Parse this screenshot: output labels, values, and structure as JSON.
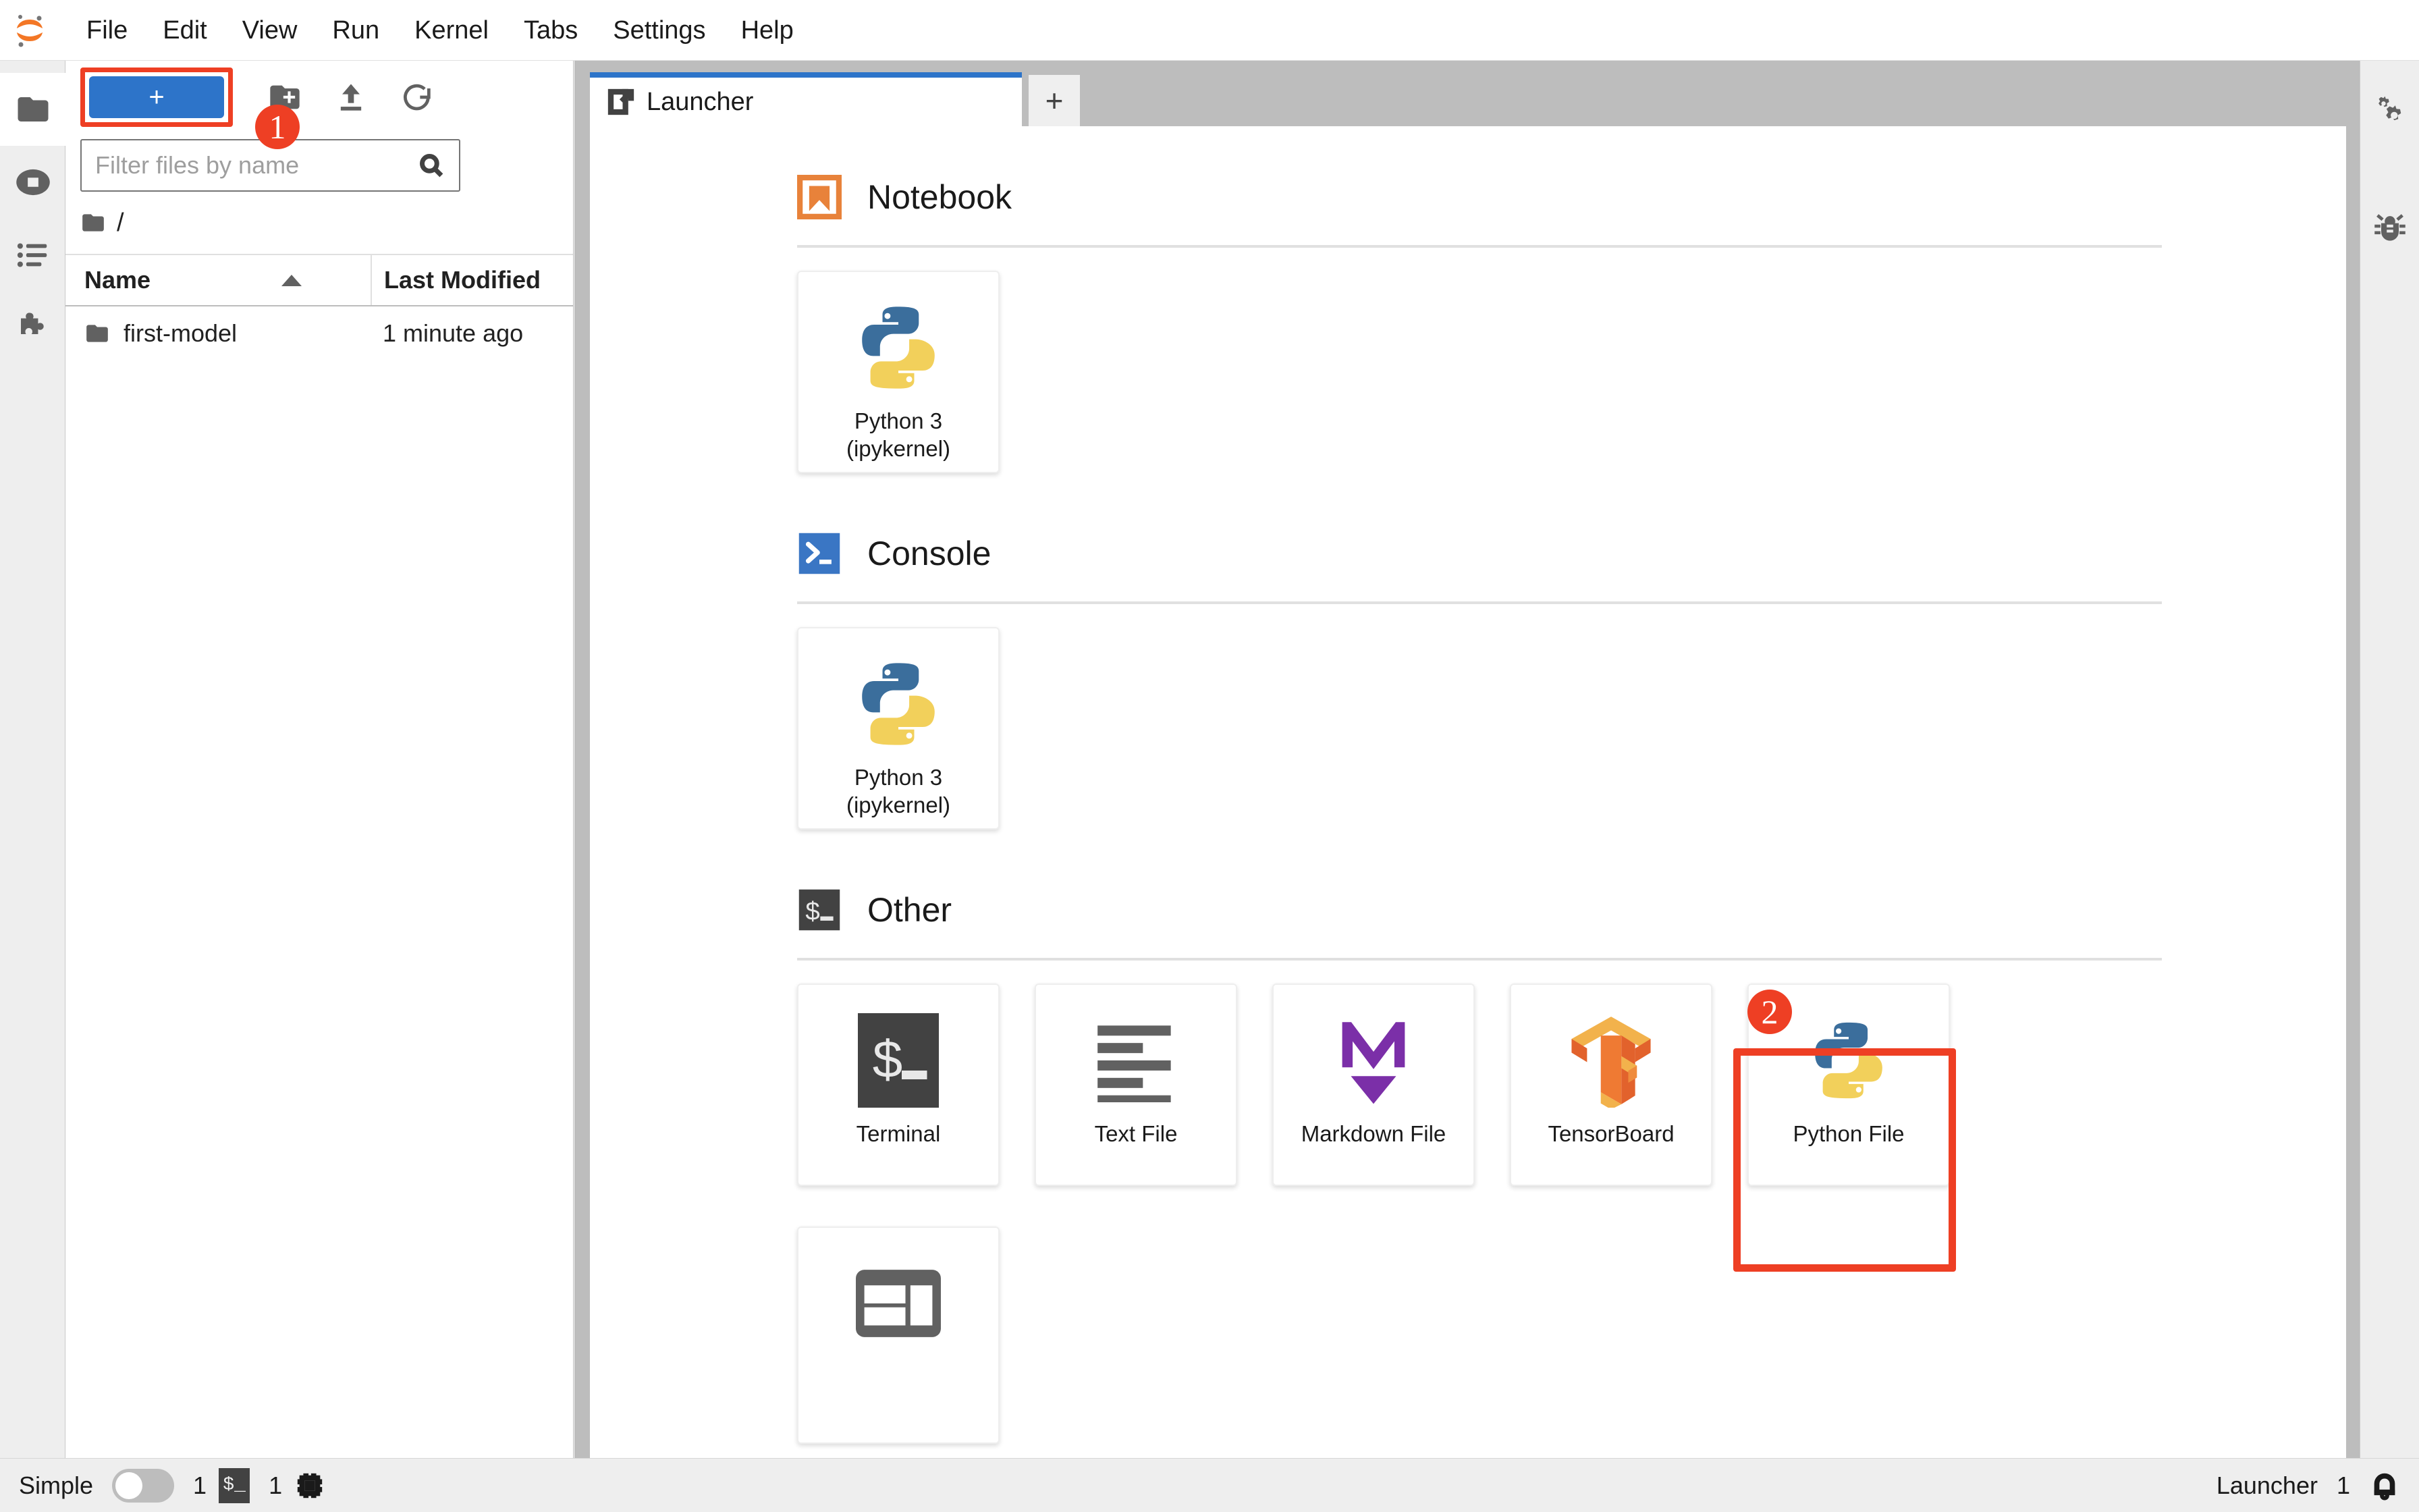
{
  "menubar": {
    "logo_name": "jupyter-logo",
    "items": [
      "File",
      "Edit",
      "View",
      "Run",
      "Kernel",
      "Tabs",
      "Settings",
      "Help"
    ]
  },
  "activitybar": {
    "items": [
      {
        "icon": "folder-icon",
        "label": "File Browser",
        "active": true
      },
      {
        "icon": "running-terminals-icon",
        "label": "Running Terminals and Kernels",
        "active": false
      },
      {
        "icon": "commands-list-icon",
        "label": "Commands",
        "active": false
      },
      {
        "icon": "extension-puzzle-icon",
        "label": "Extension Manager",
        "active": false
      }
    ]
  },
  "filebrowser": {
    "new_button_label": "+",
    "toolbar_icons": [
      "new-folder-icon",
      "upload-icon",
      "refresh-icon"
    ],
    "filter": {
      "placeholder": "Filter files by name",
      "value": ""
    },
    "breadcrumb": "/",
    "columns": {
      "name": "Name",
      "last_modified": "Last Modified"
    },
    "rows": [
      {
        "icon": "folder-icon",
        "name": "first-model",
        "last_modified": "1 minute ago"
      }
    ]
  },
  "dock": {
    "tabs": [
      {
        "label": "Launcher",
        "icon": "launcher-icon",
        "active": true
      }
    ],
    "add_tab_label": "+"
  },
  "launcher": {
    "sections": [
      {
        "title": "Notebook",
        "icon": "notebook-bookmark-icon",
        "cards": [
          {
            "label": "Python 3\n(ipykernel)",
            "icon": "python-logo-icon",
            "highlighted": false
          }
        ]
      },
      {
        "title": "Console",
        "icon": "console-prompt-icon",
        "cards": [
          {
            "label": "Python 3\n(ipykernel)",
            "icon": "python-logo-icon",
            "highlighted": false
          }
        ]
      },
      {
        "title": "Other",
        "icon": "other-shell-icon",
        "cards": [
          {
            "label": "Terminal",
            "icon": "terminal-icon",
            "highlighted": false
          },
          {
            "label": "Text File",
            "icon": "text-file-icon",
            "highlighted": false
          },
          {
            "label": "Markdown File",
            "icon": "markdown-icon",
            "highlighted": false
          },
          {
            "label": "TensorBoard",
            "icon": "tensorboard-icon",
            "highlighted": false
          },
          {
            "label": "Python File",
            "icon": "python-logo-icon",
            "highlighted": true
          }
        ],
        "cards_row2": [
          {
            "label": "",
            "icon": "contextual-help-icon",
            "highlighted": false
          }
        ]
      }
    ]
  },
  "annotations": {
    "badges": [
      {
        "id": "badge-1",
        "text": "1",
        "target": "new-launcher-button",
        "color": "#ee3f24"
      },
      {
        "id": "badge-2",
        "text": "2",
        "target": "python-file-card",
        "color": "#ee3f24"
      }
    ],
    "highlight_color": "#ee3f24"
  },
  "rightbar": {
    "items": [
      {
        "icon": "property-inspector-gears-icon",
        "label": "Property Inspector"
      },
      {
        "icon": "debugger-bug-icon",
        "label": "Debugger"
      }
    ]
  },
  "statusbar": {
    "simple_label": "Simple",
    "simple_toggle_on": false,
    "terminal_count": "1",
    "kernel_count": "1",
    "current_view": "Launcher",
    "notification_count": "1"
  },
  "colors": {
    "accent_blue": "#2d74c9",
    "highlight_red": "#ee3f24",
    "chrome_gray": "#bdbdbd",
    "panel_gray": "#eeeeee",
    "notebook_orange": "#e8823a",
    "console_blue": "#3a76c4",
    "other_dark": "#424242",
    "markdown_purple": "#7b2fa8"
  }
}
